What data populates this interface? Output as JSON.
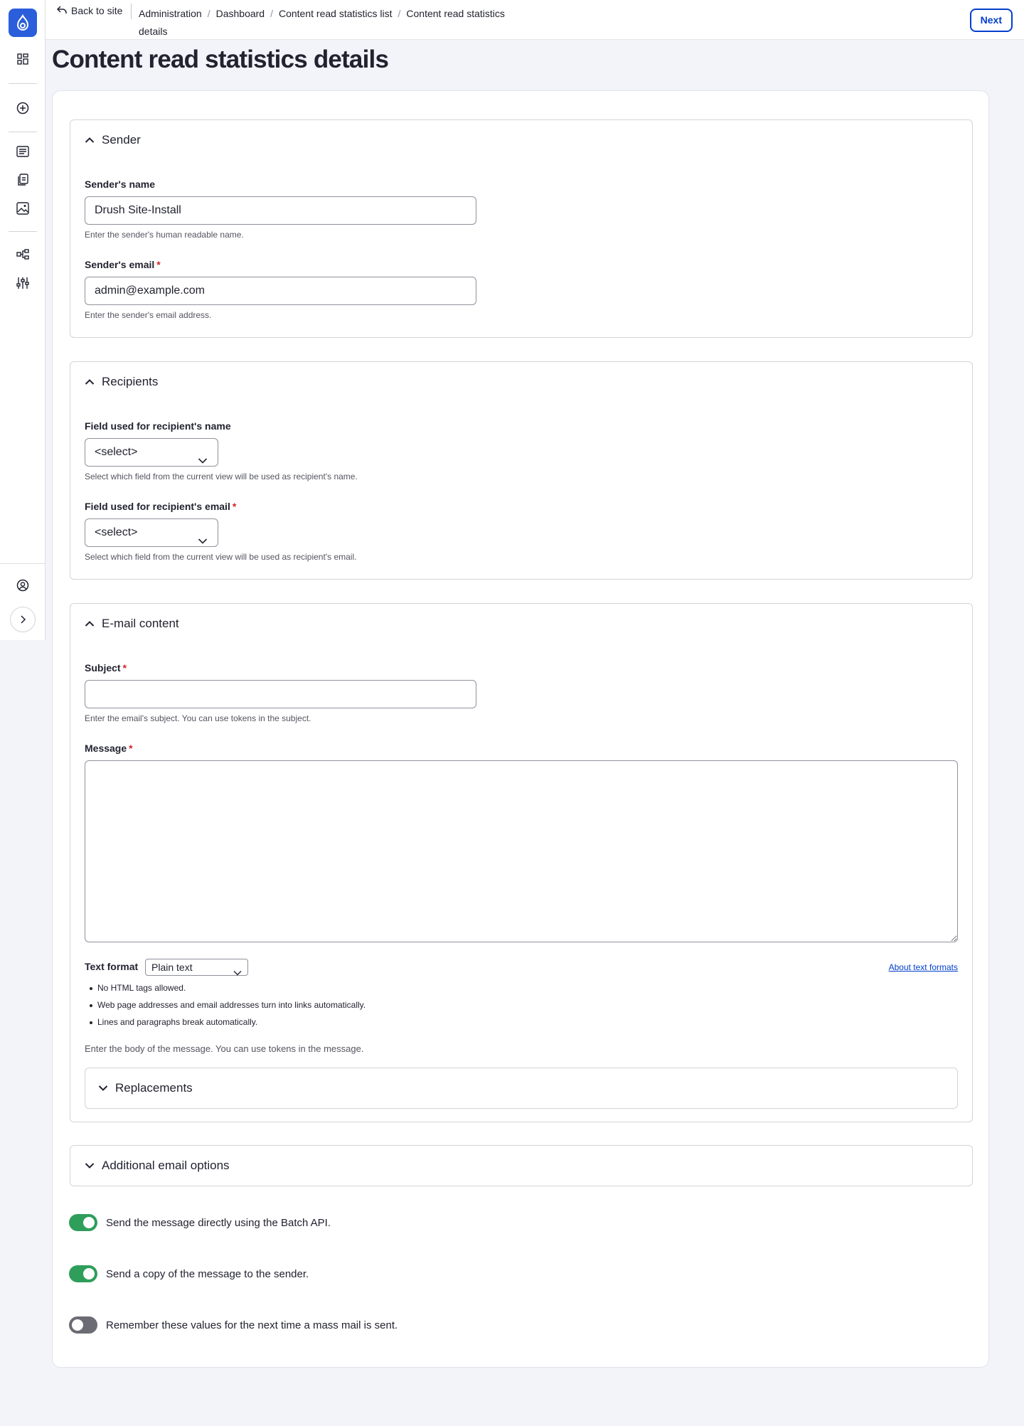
{
  "colors": {
    "accent": "#003ecc",
    "logo": "#2b5edb",
    "toggle_on": "#2e9e5a",
    "toggle_off": "#6b6c73",
    "required": "#d72222"
  },
  "toolbar": {
    "icons": [
      "drupal-logo-icon",
      "dashboard-icon",
      "add-icon",
      "content-icon",
      "files-icon",
      "media-icon",
      "structure-icon",
      "config-icon",
      "user-icon",
      "expand-icon"
    ]
  },
  "header": {
    "back_label": "Back to site",
    "breadcrumb": [
      "Administration",
      "Dashboard",
      "Content read statistics list",
      "Content read statistics",
      "details"
    ],
    "next_label": "Next"
  },
  "page": {
    "title": "Content read statistics details"
  },
  "sender": {
    "summary": "Sender",
    "name_label": "Sender's name",
    "name_value": "Drush Site-Install",
    "name_desc": "Enter the sender's human readable name.",
    "email_label": "Sender's email",
    "email_value": "admin@example.com",
    "email_desc": "Enter the sender's email address.",
    "required_mark": "*"
  },
  "recipients": {
    "summary": "Recipients",
    "name_field_label": "Field used for recipient's name",
    "name_field_value": "<select>",
    "name_field_desc": "Select which field from the current view will be used as recipient's name.",
    "email_field_label": "Field used for recipient's email",
    "email_field_value": "<select>",
    "email_field_desc": "Select which field from the current view will be used as recipient's email."
  },
  "email_content": {
    "summary": "E-mail content",
    "subject_label": "Subject",
    "subject_value": "",
    "subject_desc": "Enter the email's subject. You can use tokens in the subject.",
    "message_label": "Message",
    "message_value": "",
    "text_format_label": "Text format",
    "text_format_value": "Plain text",
    "about_link": "About text formats",
    "tips": [
      "No HTML tags allowed.",
      "Web page addresses and email addresses turn into links automatically.",
      "Lines and paragraphs break automatically."
    ],
    "message_desc": "Enter the body of the message. You can use tokens in the message.",
    "replacements_summary": "Replacements"
  },
  "additional": {
    "summary": "Additional email options"
  },
  "toggles": [
    {
      "label": "Send the message directly using the Batch API.",
      "on": true
    },
    {
      "label": "Send a copy of the message to the sender.",
      "on": true
    },
    {
      "label": "Remember these values for the next time a mass mail is sent.",
      "on": false
    }
  ]
}
